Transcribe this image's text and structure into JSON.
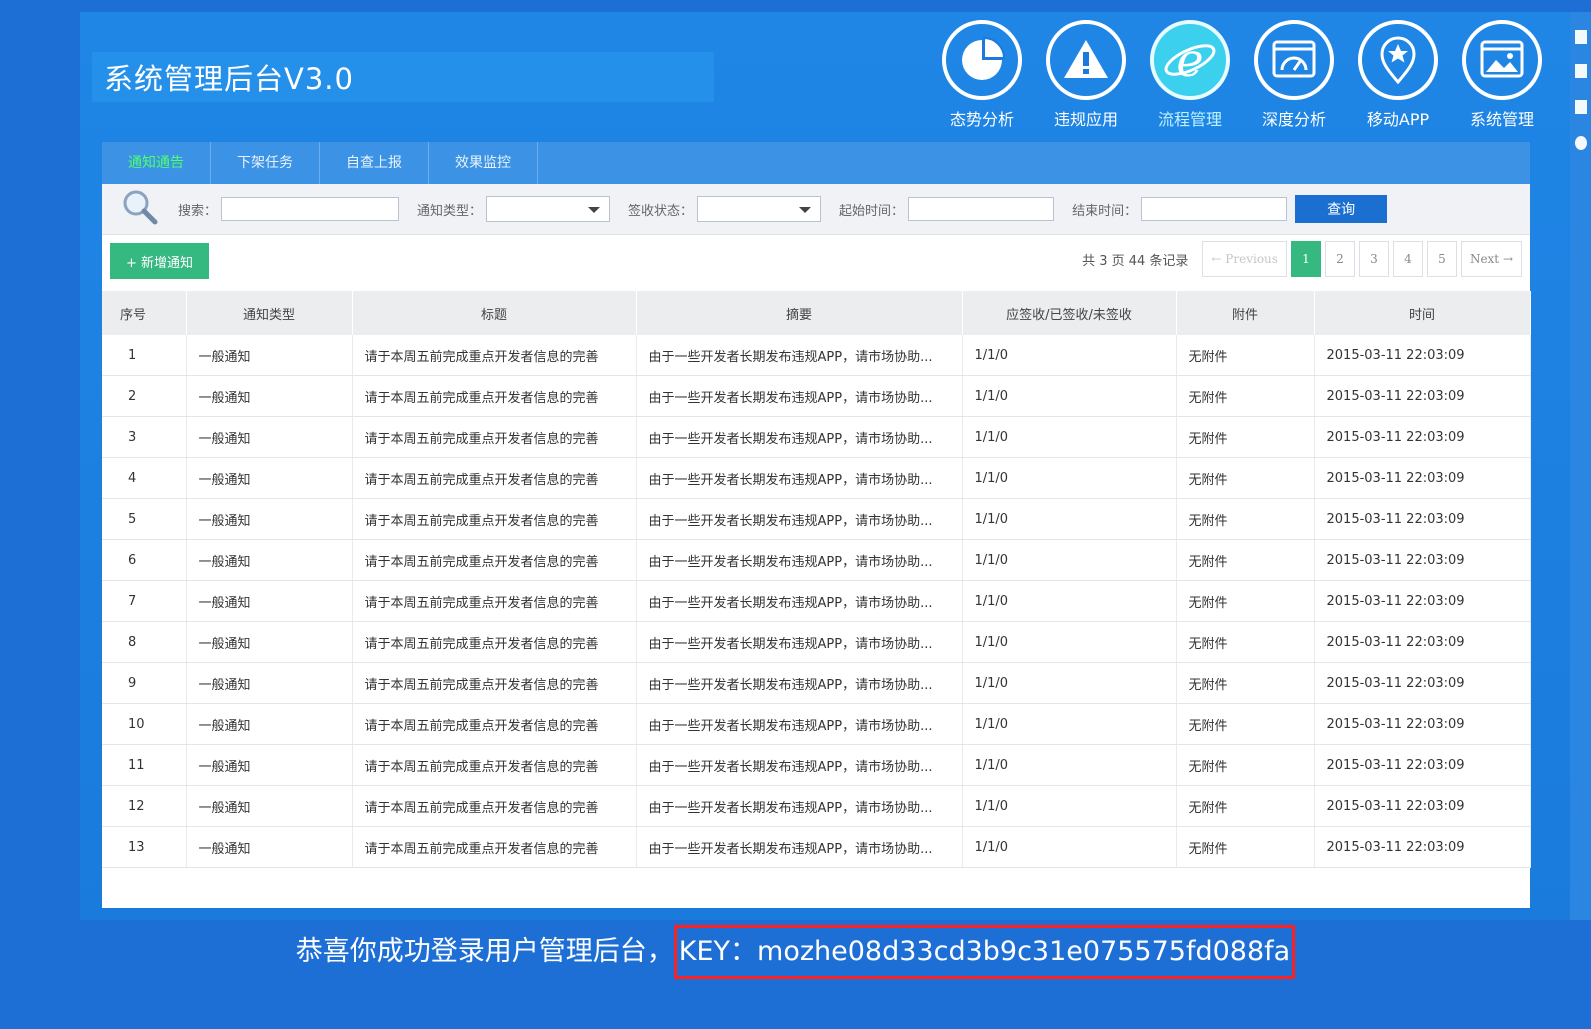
{
  "app": {
    "title": "系统管理后台V3.0"
  },
  "top_nav": [
    {
      "label": "态势分析",
      "icon": "pie-chart-icon",
      "active": false
    },
    {
      "label": "违规应用",
      "icon": "warning-icon",
      "active": false
    },
    {
      "label": "流程管理",
      "icon": "ie-browser-icon",
      "active": true
    },
    {
      "label": "深度分析",
      "icon": "gauge-window-icon",
      "active": false
    },
    {
      "label": "移动APP",
      "icon": "star-pin-icon",
      "active": false
    },
    {
      "label": "系统管理",
      "icon": "settings-window-icon",
      "active": false
    }
  ],
  "tabs": [
    {
      "label": "通知通告",
      "active": true
    },
    {
      "label": "下架任务",
      "active": false
    },
    {
      "label": "自查上报",
      "active": false
    },
    {
      "label": "效果监控",
      "active": false
    }
  ],
  "filters": {
    "search_label": "搜索：",
    "type_label": "通知类型：",
    "status_label": "签收状态：",
    "start_label": "起始时间：",
    "end_label": "结束时间：",
    "query_button": "查询"
  },
  "toolbar": {
    "add_button": "+ 新增通知"
  },
  "pager": {
    "info": "共 3 页 44 条记录",
    "previous": "← Previous",
    "pages": [
      "1",
      "2",
      "3",
      "4",
      "5"
    ],
    "current": "1",
    "next": "Next →"
  },
  "table": {
    "headers": [
      "序号",
      "通知类型",
      "标题",
      "摘要",
      "应签收/已签收/未签收",
      "附件",
      "时间"
    ],
    "rows": [
      [
        "1",
        "一般通知",
        "请于本周五前完成重点开发者信息的完善",
        "由于一些开发者长期发布违规APP，请市场协助...",
        "1/1/0",
        "无附件",
        "2015-03-11 22:03:09"
      ],
      [
        "2",
        "一般通知",
        "请于本周五前完成重点开发者信息的完善",
        "由于一些开发者长期发布违规APP，请市场协助...",
        "1/1/0",
        "无附件",
        "2015-03-11 22:03:09"
      ],
      [
        "3",
        "一般通知",
        "请于本周五前完成重点开发者信息的完善",
        "由于一些开发者长期发布违规APP，请市场协助...",
        "1/1/0",
        "无附件",
        "2015-03-11 22:03:09"
      ],
      [
        "4",
        "一般通知",
        "请于本周五前完成重点开发者信息的完善",
        "由于一些开发者长期发布违规APP，请市场协助...",
        "1/1/0",
        "无附件",
        "2015-03-11 22:03:09"
      ],
      [
        "5",
        "一般通知",
        "请于本周五前完成重点开发者信息的完善",
        "由于一些开发者长期发布违规APP，请市场协助...",
        "1/1/0",
        "无附件",
        "2015-03-11 22:03:09"
      ],
      [
        "6",
        "一般通知",
        "请于本周五前完成重点开发者信息的完善",
        "由于一些开发者长期发布违规APP，请市场协助...",
        "1/1/0",
        "无附件",
        "2015-03-11 22:03:09"
      ],
      [
        "7",
        "一般通知",
        "请于本周五前完成重点开发者信息的完善",
        "由于一些开发者长期发布违规APP，请市场协助...",
        "1/1/0",
        "无附件",
        "2015-03-11 22:03:09"
      ],
      [
        "8",
        "一般通知",
        "请于本周五前完成重点开发者信息的完善",
        "由于一些开发者长期发布违规APP，请市场协助...",
        "1/1/0",
        "无附件",
        "2015-03-11 22:03:09"
      ],
      [
        "9",
        "一般通知",
        "请于本周五前完成重点开发者信息的完善",
        "由于一些开发者长期发布违规APP，请市场协助...",
        "1/1/0",
        "无附件",
        "2015-03-11 22:03:09"
      ],
      [
        "10",
        "一般通知",
        "请于本周五前完成重点开发者信息的完善",
        "由于一些开发者长期发布违规APP，请市场协助...",
        "1/1/0",
        "无附件",
        "2015-03-11 22:03:09"
      ],
      [
        "11",
        "一般通知",
        "请于本周五前完成重点开发者信息的完善",
        "由于一些开发者长期发布违规APP，请市场协助...",
        "1/1/0",
        "无附件",
        "2015-03-11 22:03:09"
      ],
      [
        "12",
        "一般通知",
        "请于本周五前完成重点开发者信息的完善",
        "由于一些开发者长期发布违规APP，请市场协助...",
        "1/1/0",
        "无附件",
        "2015-03-11 22:03:09"
      ],
      [
        "13",
        "一般通知",
        "请于本周五前完成重点开发者信息的完善",
        "由于一些开发者长期发布违规APP，请市场协助...",
        "1/1/0",
        "无附件",
        "2015-03-11 22:03:09"
      ]
    ]
  },
  "banner": {
    "prefix": "恭喜你成功登录用户管理后台，",
    "key": "KEY：mozhe08d33cd3b9c31e075575fd088fa"
  },
  "colors": {
    "background": "#1d6fd6",
    "accent_green": "#35b981",
    "active_tab": "#4dff6a",
    "key_box": "#ff2020"
  }
}
